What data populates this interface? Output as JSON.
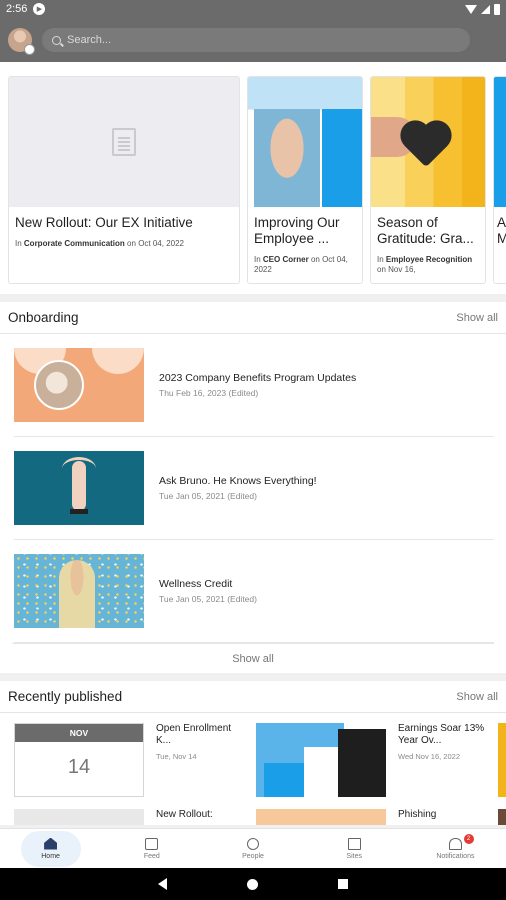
{
  "status": {
    "time": "2:56"
  },
  "search": {
    "placeholder": "Search..."
  },
  "featured": [
    {
      "title": "New Rollout: Our EX Initiative",
      "in_label": "In",
      "category": "Corporate Communication",
      "on_label": "on",
      "date": "Oct 04, 2022"
    },
    {
      "title": "Improving Our Employee ...",
      "in_label": "In",
      "category": "CEO Corner",
      "on_label": "on",
      "date": "Oct 04, 2022"
    },
    {
      "title": "Season of Gratitude: Gra...",
      "in_label": "In",
      "category": "Employee Recognition",
      "on_label": "on",
      "date": "Nov 16,"
    },
    {
      "title": "A M"
    }
  ],
  "onboarding": {
    "heading": "Onboarding",
    "show_all": "Show all",
    "items": [
      {
        "title": "2023 Company Benefits Program Updates",
        "date": "Thu Feb 16, 2023 (Edited)"
      },
      {
        "title": "Ask Bruno. He Knows Everything!",
        "date": "Tue Jan 05, 2021 (Edited)"
      },
      {
        "title": "Wellness Credit",
        "date": "Tue Jan 05, 2021 (Edited)"
      }
    ],
    "show_all_bottom": "Show all"
  },
  "recent": {
    "heading": "Recently published",
    "show_all": "Show all",
    "items": [
      {
        "month": "NOV",
        "day": "14",
        "title": "Open Enrollment K...",
        "date": "Tue, Nov 14"
      },
      {
        "title": "Earnings Soar 13% Year Ov...",
        "date": "Wed Nov 16, 2022"
      }
    ],
    "partial": [
      {
        "title": "New Rollout:"
      },
      {
        "title": "Phishing"
      }
    ]
  },
  "bottom_nav": [
    {
      "label": "Home",
      "icon": "home-icon"
    },
    {
      "label": "Feed",
      "icon": "feed-icon"
    },
    {
      "label": "People",
      "icon": "people-icon"
    },
    {
      "label": "Sites",
      "icon": "sites-icon"
    },
    {
      "label": "Notifications",
      "icon": "bell-icon",
      "badge": "2"
    }
  ],
  "colors": {
    "topbar": "#6b6b6b",
    "accent_blue": "#1a9ee8",
    "badge_red": "#e53935"
  }
}
